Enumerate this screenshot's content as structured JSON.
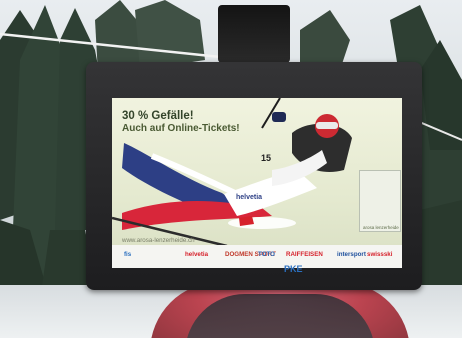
{
  "ad": {
    "headline": "30 % Gefälle!",
    "subline": "Auch auf Online-Tickets!",
    "url": "www.arosa-lenzerheide.ch",
    "racer_bib": "15",
    "side_ad_text": "arosa lenzerheide"
  },
  "sponsors": [
    "helvetia",
    "DOGMEN SPORT",
    "TOTO",
    "RAIFFEISEN",
    "intersport",
    "swissski"
  ],
  "logos": {
    "fis_mark": "fis",
    "skier_suit_brand": "helvetia",
    "screen_brand": "PKE"
  },
  "colors": {
    "screen_bg": "#e9eed6",
    "headline": "#33442a",
    "brand_blue": "#2a6fbf",
    "helvetia_red": "#d6212b",
    "gondola_red": "#b7323f"
  }
}
